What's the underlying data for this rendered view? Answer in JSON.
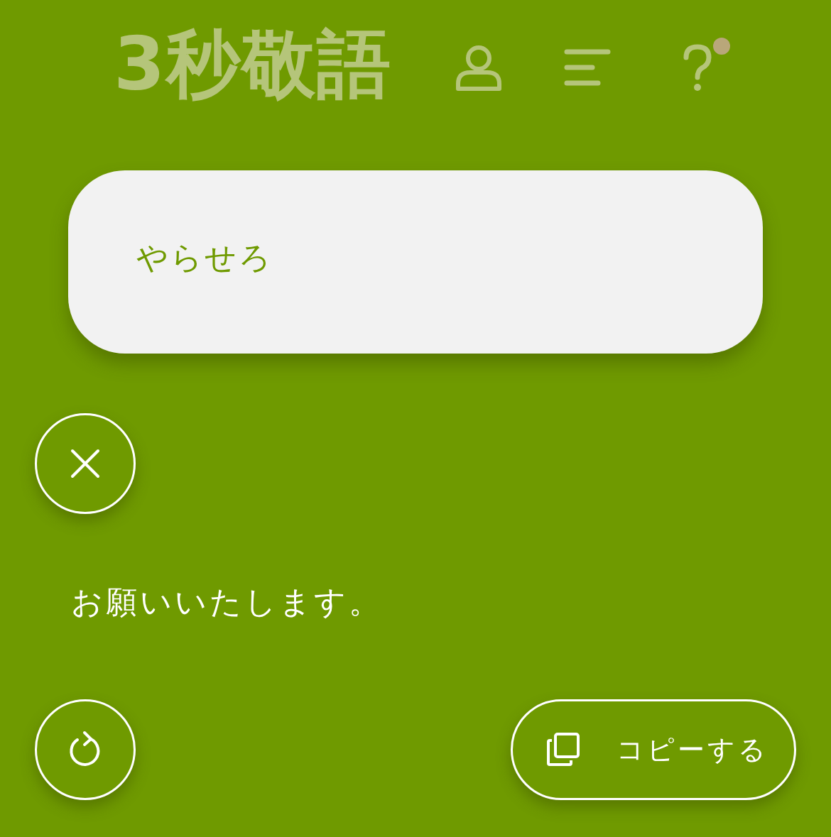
{
  "header": {
    "logo": "3秒敬語",
    "help_notification": true
  },
  "input": {
    "value": "やらせろ"
  },
  "result": {
    "text": "お願いいたします。"
  },
  "copy_button": {
    "label": "コピーする"
  }
}
